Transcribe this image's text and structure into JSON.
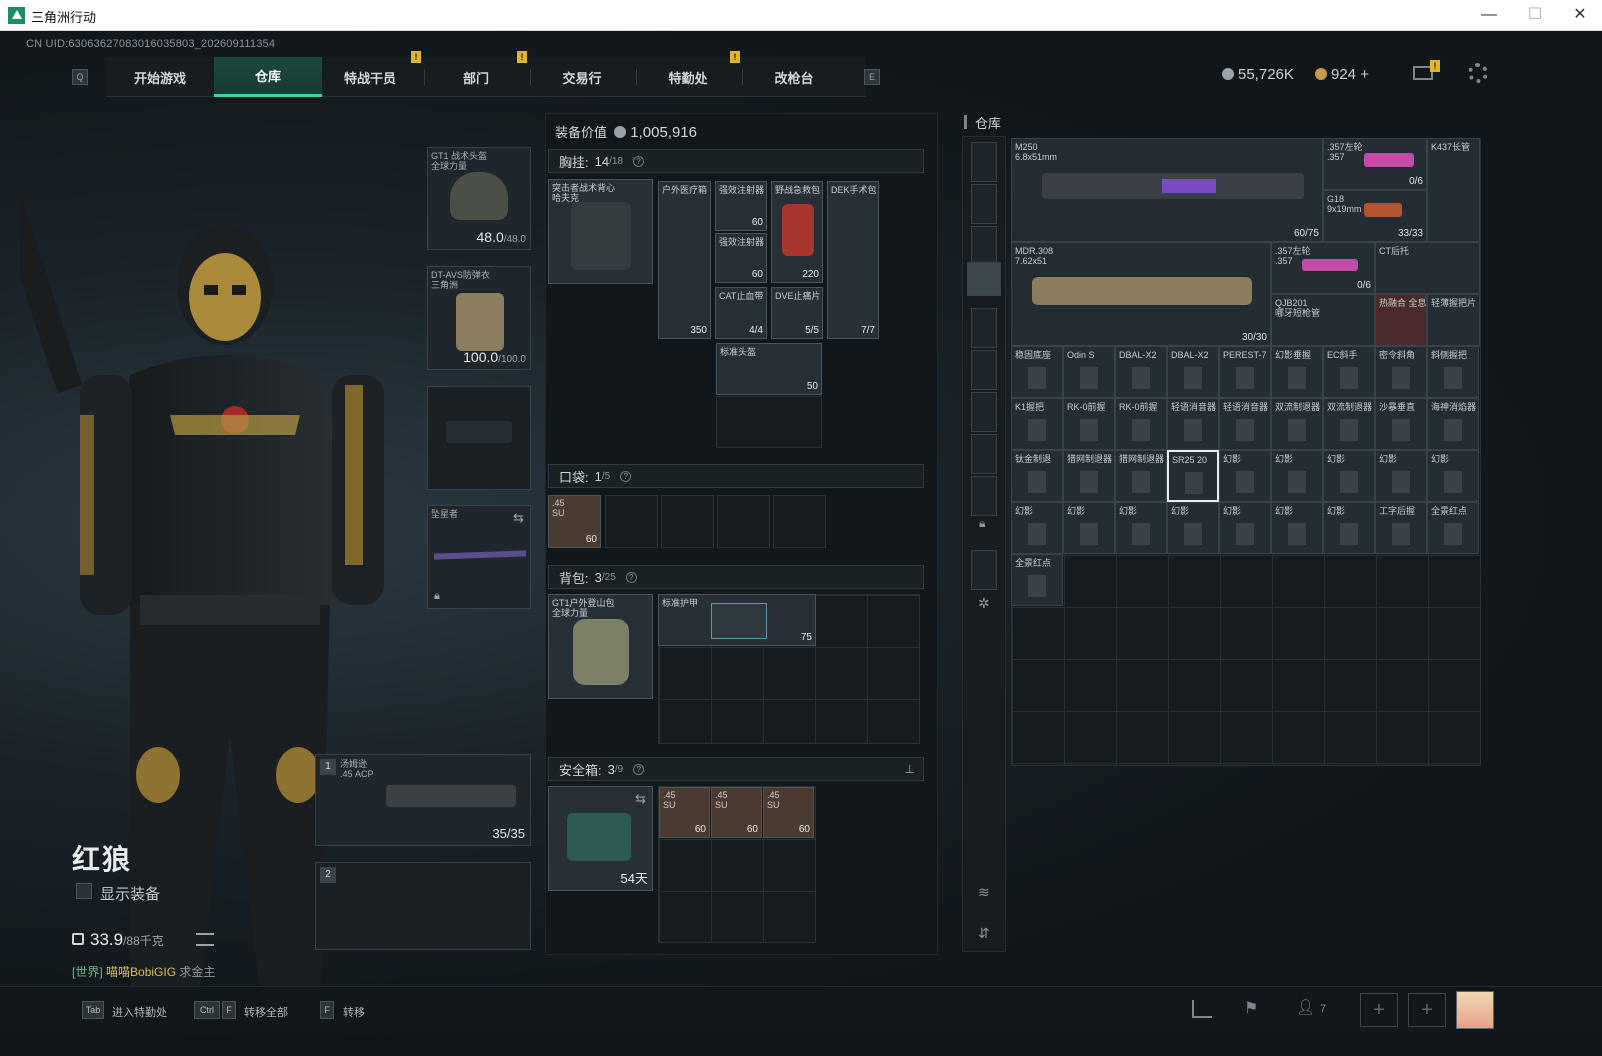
{
  "window": {
    "title": "三角洲行动",
    "minimize": "—",
    "maximize": "☐",
    "close": "✕"
  },
  "uid": "CN UID:6306362708301603580​3_202609111354",
  "nav": {
    "key_left": "Q",
    "key_right": "E",
    "tabs": [
      "开始游戏",
      "仓库",
      "特战干员",
      "部门",
      "交易行",
      "特勤处",
      "改枪台"
    ],
    "active": "仓库",
    "alerts": [
      "!",
      "!",
      "!"
    ]
  },
  "header": {
    "silver": "55,726K",
    "gold": "924",
    "gold_plus": "+",
    "mail_alert": "!"
  },
  "character": {
    "name": "红狼",
    "show_equipment": "显示装备",
    "weight": "33.9",
    "weight_max": "/88千克",
    "chat_prefix": "[世界]",
    "chat_user": "喵喵BobiGIG",
    "chat_text": "求金主"
  },
  "equipment": {
    "helmet": {
      "label": "GT1 战术头盔\n全球力量",
      "value": "48.0",
      "max": "/48.0"
    },
    "armor": {
      "label": "DT-AVS防弹衣\n三角洲",
      "value": "100.0",
      "max": "/100.0"
    },
    "melee": {
      "label": "坠星者"
    },
    "primary": {
      "slot": "1",
      "label": "汤姆逊",
      "ammo_type": ".45 ACP",
      "ammo": "35/35"
    },
    "secondary": {
      "slot": "2"
    }
  },
  "middle": {
    "value_label": "装备价值",
    "value": "1,005,916",
    "chest": {
      "title": "胸挂:",
      "count": "14",
      "max": "/18",
      "rig_name": "突击者战术背心\n哈夫克"
    },
    "pocket": {
      "title": "口袋:",
      "count": "1",
      "max": "/5"
    },
    "backpack": {
      "title": "背包:",
      "count": "3",
      "max": "/25",
      "bag_name": "GT1户外登山包\n全球力量",
      "armor_item": "标准护甲",
      "armor_dur": "75"
    },
    "safe": {
      "title": "安全箱:",
      "count": "3",
      "max": "/9",
      "days": "54天"
    },
    "chest_items": [
      {
        "name": "户外医疗箱",
        "count": "350"
      },
      {
        "name": "强效注射器",
        "count": "60"
      },
      {
        "name": "强效注射器",
        "count": "60"
      },
      {
        "name": "野战急救包",
        "count": "220"
      },
      {
        "name": "DEK手术包",
        "count": "7/7"
      },
      {
        "name": "CAT止血带",
        "count": "4/4"
      },
      {
        "name": "DVE止痛片",
        "count": "5/5"
      },
      {
        "name": "标准头盔",
        "count": "50"
      }
    ],
    "ammo_label": ".45\nSU",
    "ammo_count": "60",
    "safe_ammo": [
      {
        "label": ".45\nSU",
        "count": "60"
      },
      {
        "label": ".45\nSU",
        "count": "60"
      },
      {
        "label": ".45\nSU",
        "count": "60"
      }
    ]
  },
  "warehouse": {
    "title": "仓库",
    "big": [
      {
        "name": "M250\n6.8x51mm",
        "count": "60/75"
      },
      {
        "name": ".357左轮\n.357",
        "count": "0/6"
      },
      {
        "name": "K437长管",
        "count": ""
      },
      {
        "name": "G18\n9x19mm",
        "count": "33/33"
      },
      {
        "name": "MDR.308\n7.62x51",
        "count": "30/30"
      },
      {
        "name": ".357左轮\n.357",
        "count": "0/6"
      },
      {
        "name": "CT后托",
        "count": ""
      },
      {
        "name": "QJB201\n哪牙短枪管",
        "count": ""
      },
      {
        "name": "热融合 全息",
        "count": ""
      },
      {
        "name": "轻薄握把片",
        "count": ""
      }
    ],
    "rows": [
      [
        "稳固底座",
        "Odin S",
        "DBAL-X2",
        "DBAL-X2",
        "PEREST-7",
        "幻影垂握",
        "EC斜手",
        "密令斜角",
        "斜侧握把"
      ],
      [
        "K1握把",
        "RK-0前握",
        "RK-0前握",
        "轻语消音器",
        "轻语消音器",
        "双流制退器",
        "双流制退器",
        "沙暴垂直",
        "海神消焰器"
      ],
      [
        "钛金制退",
        "猎网制退器",
        "猎网制退器",
        "SR25 20",
        "幻影",
        "幻影",
        "幻影",
        "幻影",
        "幻影"
      ],
      [
        "幻影",
        "幻影",
        "幻影",
        "幻影",
        "幻影",
        "幻影",
        "幻影",
        "工字后握",
        "全景红点"
      ],
      [
        "全景红点"
      ]
    ]
  },
  "bottom": {
    "tab_key": "Tab",
    "tab_label": "进入特勤处",
    "ctrl_key": "Ctrl",
    "f_key": "F",
    "transfer_all": "转移全部",
    "f2_key": "F",
    "transfer": "转移",
    "friends": "7"
  },
  "colors": {
    "accent": "#3dd4a0",
    "alert": "#e2b629",
    "panel": "#11171b"
  }
}
